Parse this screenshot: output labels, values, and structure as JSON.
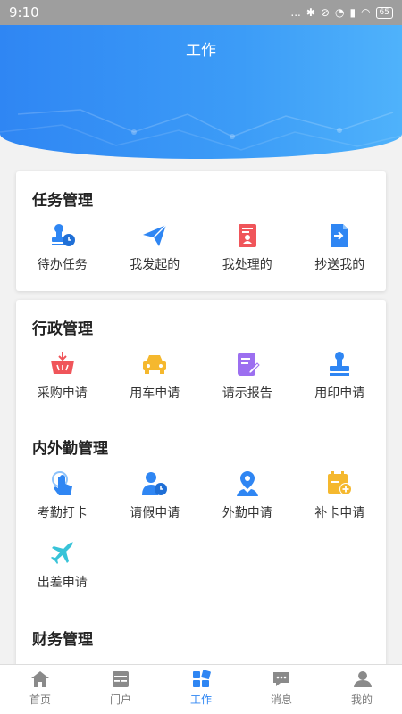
{
  "status_bar": {
    "time": "9:10",
    "signal": "...",
    "battery": "65"
  },
  "header": {
    "title": "工作"
  },
  "sections": {
    "task": {
      "title": "任务管理",
      "items": [
        {
          "label": "待办任务",
          "icon": "stamp-clock-icon"
        },
        {
          "label": "我发起的",
          "icon": "paper-plane-icon"
        },
        {
          "label": "我处理的",
          "icon": "document-user-icon"
        },
        {
          "label": "抄送我的",
          "icon": "document-arrow-icon"
        }
      ]
    },
    "admin": {
      "title": "行政管理",
      "items": [
        {
          "label": "采购申请",
          "icon": "basket-icon"
        },
        {
          "label": "用车申请",
          "icon": "car-icon"
        },
        {
          "label": "请示报告",
          "icon": "document-edit-icon"
        },
        {
          "label": "用印申请",
          "icon": "stamp-icon"
        }
      ]
    },
    "attendance": {
      "title": "内外勤管理",
      "items": [
        {
          "label": "考勤打卡",
          "icon": "touch-icon"
        },
        {
          "label": "请假申请",
          "icon": "user-clock-icon"
        },
        {
          "label": "外勤申请",
          "icon": "location-user-icon"
        },
        {
          "label": "补卡申请",
          "icon": "calendar-add-icon"
        },
        {
          "label": "出差申请",
          "icon": "airplane-icon"
        }
      ]
    },
    "finance": {
      "title": "财务管理"
    }
  },
  "tabbar": {
    "items": [
      {
        "label": "首页",
        "icon": "home-icon"
      },
      {
        "label": "门户",
        "icon": "portal-icon"
      },
      {
        "label": "工作",
        "icon": "work-grid-icon"
      },
      {
        "label": "消息",
        "icon": "message-icon"
      },
      {
        "label": "我的",
        "icon": "user-icon"
      }
    ],
    "active_index": 2
  },
  "colors": {
    "primary": "#2f86f3",
    "red": "#f0555a",
    "yellow": "#f5b82e",
    "purple": "#9c6ff0",
    "cyan": "#38c3d8"
  }
}
